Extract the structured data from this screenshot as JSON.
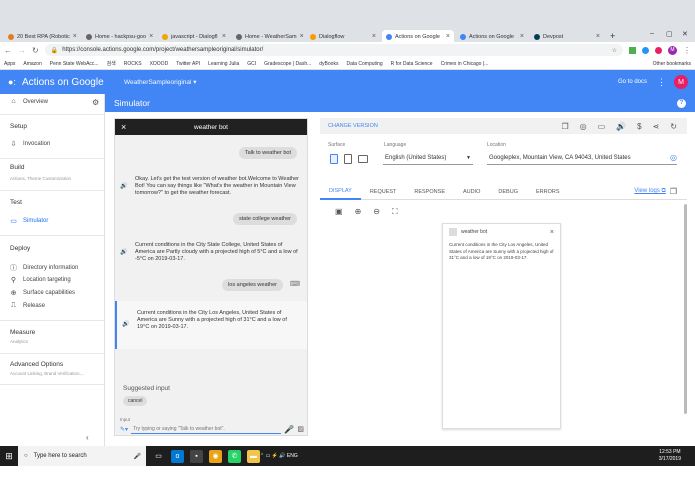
{
  "browser": {
    "tabs": [
      {
        "label": "20 Best RPA (Robotic",
        "active": false,
        "color": "#e67c22"
      },
      {
        "label": "Home - hackpsu-goo",
        "active": false,
        "color": "#666666"
      },
      {
        "label": "javascript - Dialogfl",
        "active": false,
        "color": "#f4a300"
      },
      {
        "label": "Home - WeatherSam",
        "active": false,
        "color": "#666666"
      },
      {
        "label": "Dialogflow",
        "active": false,
        "color": "#ff9800"
      },
      {
        "label": "Actions on Google",
        "active": true,
        "color": "#4285f4"
      },
      {
        "label": "Actions on Google",
        "active": false,
        "color": "#4285f4"
      },
      {
        "label": "Devpost",
        "active": false,
        "color": "#003e54"
      }
    ],
    "new_tab": "+",
    "window_controls": [
      "–",
      "▢",
      "✕"
    ],
    "url": "https://console.actions.google.com/project/weathersampleoriginal/simulator/",
    "bookmarks": [
      "Apps",
      "Amazon",
      "Penn State WebAcc...",
      "검색",
      "ROCKS",
      "XOOOD",
      "Twitter API",
      "Learning Julia",
      "GCI",
      "Gradescope | Dash...",
      "dyBooks",
      "Data Computing",
      "R for Data Science",
      "Crimes in Chicago |..."
    ],
    "other_bookmarks": "Other bookmarks"
  },
  "app": {
    "brand": "Actions on Google",
    "project": "WeatherSampleoriginal",
    "go_to_docs": "Go to docs",
    "avatar": "M"
  },
  "sidebar": {
    "overview": "Overview",
    "setup": "Setup",
    "invocation": "Invocation",
    "build": "Build",
    "build_sub": "Actions, Theme Customization",
    "test": "Test",
    "simulator": "Simulator",
    "deploy": "Deploy",
    "directory": "Directory information",
    "location": "Location targeting",
    "surface": "Surface capabilities",
    "release": "Release",
    "measure": "Measure",
    "measure_sub": "Analytics",
    "advanced": "Advanced Options",
    "advanced_sub": "Account Linking, Brand Verification,..."
  },
  "simulator": {
    "title": "Simulator",
    "chat_title": "weather bot",
    "messages": [
      {
        "from": "user",
        "text": "Talk to weather bot"
      },
      {
        "from": "bot",
        "text": "Okay. Let's get the test version of weather bot.Welcome to Weather Bot! You can say things like \"What's the weather in Mountain View tomorrow?\" to get the weather forecast."
      },
      {
        "from": "user",
        "text": "state college weather"
      },
      {
        "from": "bot",
        "text": "Current conditions in the City State College, United States of America are Partly cloudy with a projected high of 5°C and a low of -5°C on 2019-03-17."
      },
      {
        "from": "user",
        "text": "los angeles weather"
      },
      {
        "from": "bot",
        "text": "Current conditions in the City Los Angeles, United States of America are Sunny with a projected high of 31°C and a low of 19°C on 2019-03-17."
      }
    ],
    "suggested_label": "Suggested input",
    "suggestion": "cancel",
    "input_label": "Input",
    "input_placeholder": "Try typing or saying \"Talk to weather bot\"."
  },
  "panel": {
    "change_version": "CHANGE VERSION",
    "surface_label": "Surface",
    "language_label": "Language",
    "language_value": "English (United States)",
    "location_label": "Location",
    "location_value": "Googleplex, Mountain View, CA 94043, United States",
    "tabs": [
      "DISPLAY",
      "REQUEST",
      "RESPONSE",
      "AUDIO",
      "DEBUG",
      "ERRORS"
    ],
    "view_logs": "View logs",
    "card_title": "weather bot",
    "card_text": "Current conditions in the City Los Angeles, United States of America are Sunny with a projected high of 31°C and a low of 19°C on 2019-03-17."
  },
  "taskbar": {
    "search_placeholder": "Type here to search",
    "lang": "ENG",
    "time": "12:53 PM",
    "date": "3/17/2019"
  }
}
